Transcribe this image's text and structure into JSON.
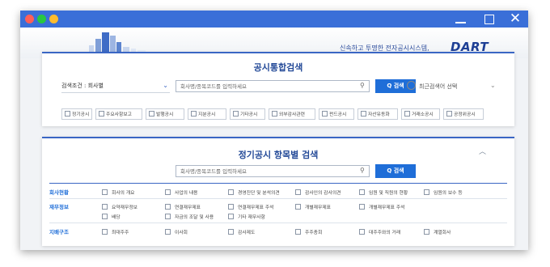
{
  "header": {
    "tagline": "신속하고 투명한 전자공시시스템,",
    "logo": "DART"
  },
  "integrated_search": {
    "title": "공시통합검색",
    "condition_label": "검색조건 : 회사별",
    "input_placeholder": "회사명/종목코드를 입력하세요",
    "search_button": "Q 검색",
    "recent_label": "최근검색어 선택",
    "categories": [
      "정기공시",
      "주요사항보고",
      "발행공시",
      "지분공시",
      "기타공시",
      "외부감사관련",
      "펀드공시",
      "자산유동화",
      "거래소공시",
      "공정위공시"
    ]
  },
  "periodic_search": {
    "title": "정기공시 항목별 검색",
    "input_placeholder": "회사명/종목코드를 입력하세요",
    "search_button": "Q 검색",
    "groups": [
      {
        "label": "회사현황",
        "items": [
          "회사의 개요",
          "사업의 내용",
          "경영진단 및 분석의견",
          "감사인의 감사의견",
          "임원 및 직원의 현황",
          "임원의 보수 등"
        ]
      },
      {
        "label": "재무정보",
        "items": [
          "요약재무정보",
          "연결재무제표",
          "연결재무제표 주석",
          "개별재무제표",
          "개별재무제표 주석",
          "배당",
          "자금의 조달 및 사용",
          "기타 재무사항"
        ]
      },
      {
        "label": "지배구조",
        "items": [
          "최대주주",
          "이사회",
          "감사제도",
          "주주총회",
          "대주주와의 거래",
          "계열회사"
        ]
      }
    ]
  },
  "colors": {
    "titlebar": "#3a6fd8",
    "accent": "#1f6ed8",
    "heading": "#244a98"
  }
}
